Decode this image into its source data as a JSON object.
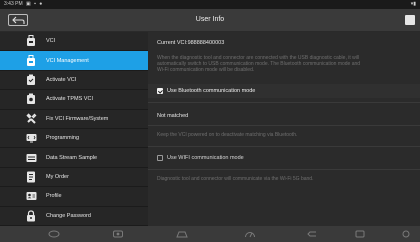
{
  "status_bar": {
    "time": "3:43 PM",
    "left_icons": "▣ ▪ ●",
    "right_icons": "▾▮"
  },
  "header": {
    "title": "User Info"
  },
  "sidebar": {
    "items": [
      {
        "label": "VCI",
        "icon": "vci-icon",
        "active": false
      },
      {
        "label": "VCI Management",
        "icon": "vci-management-icon",
        "active": true
      },
      {
        "label": "Activate VCI",
        "icon": "activate-vci-icon",
        "active": false
      },
      {
        "label": "Activate TPMS VCI",
        "icon": "tpms-icon",
        "active": false
      },
      {
        "label": "Fix VCI Firmware/System",
        "icon": "wrench-icon",
        "active": false
      },
      {
        "label": "Programming",
        "icon": "programming-icon",
        "active": false
      },
      {
        "label": "Data Stream Sample",
        "icon": "data-stream-icon",
        "active": false
      },
      {
        "label": "My Order",
        "icon": "order-icon",
        "active": false
      },
      {
        "label": "Profile",
        "icon": "profile-icon",
        "active": false
      },
      {
        "label": "Change Password",
        "icon": "lock-icon",
        "active": false
      }
    ]
  },
  "content": {
    "current_vci": "Current VCI:988888400003",
    "usb_desc_line1": "When the diagnostic tool and connector are connected with the USB diagnostic cable, it will",
    "usb_desc_line2": "automatically switch to USB communication mode. The Bluetooth communication mode and",
    "usb_desc_line3": "Wi-Fi communication mode will be disabled.",
    "bluetooth_label": "Use Bluetooth communication mode",
    "bluetooth_checked": true,
    "match_status": "Not matched",
    "keep_desc": "Keep the VCI powered on to deactivate matching via Bluetooth.",
    "wifi_label": "Use WIFI communication mode",
    "wifi_checked": false,
    "wifi_desc": "Diagnostic tool and connector will communicate via the Wi-Fi 5G band."
  },
  "colors": {
    "accent": "#1ea0e6",
    "background": "#2b2b2b",
    "sidebar": "#262626",
    "header": "#3a3a3a"
  },
  "navbar": {
    "icons": [
      "nav-home-icon",
      "nav-car-icon",
      "nav-camera-icon",
      "nav-gauge-icon",
      "nav-back-icon",
      "nav-recent-icon",
      "nav-screenshot-icon"
    ]
  }
}
